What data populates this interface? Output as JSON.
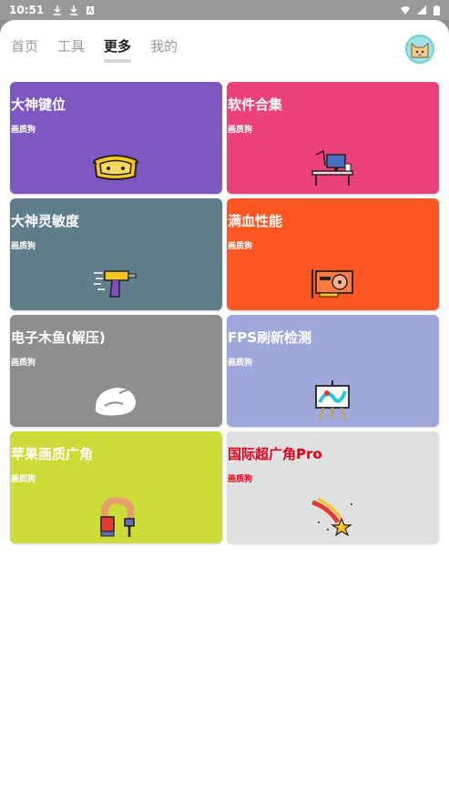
{
  "status_bar": {
    "time": "10:51"
  },
  "tabs": [
    {
      "label": "首页",
      "active": false
    },
    {
      "label": "工具",
      "active": false
    },
    {
      "label": "更多",
      "active": true
    },
    {
      "label": "我的",
      "active": false
    }
  ],
  "cards": [
    {
      "title": "大神键位",
      "subtitle": "画质狗",
      "color": "#7e57c2",
      "icon": "goggles-icon"
    },
    {
      "title": "软件合集",
      "subtitle": "画质狗",
      "color": "#ec407a",
      "icon": "workstation-desk-icon"
    },
    {
      "title": "大神灵敏度",
      "subtitle": "画质狗",
      "color": "#607d8b",
      "icon": "drill-tool-icon"
    },
    {
      "title": "满血性能",
      "subtitle": "画质狗",
      "color": "#ff5722",
      "icon": "graphics-card-icon"
    },
    {
      "title": "电子木鱼(解压)",
      "subtitle": "画质狗",
      "color": "#8e8e8e",
      "icon": "wooden-fish-icon"
    },
    {
      "title": "FPS刷新检测",
      "subtitle": "画质狗",
      "color": "#9fa8da",
      "icon": "easel-painting-icon"
    },
    {
      "title": "苹果画质广角",
      "subtitle": "画质狗",
      "color": "#cddc39",
      "icon": "paint-brush-icon"
    },
    {
      "title": "国际超广角Pro",
      "subtitle": "画质狗",
      "color": "#e0e0e0",
      "text_color": "#e0001b",
      "icon": "shooting-star-icon"
    }
  ]
}
